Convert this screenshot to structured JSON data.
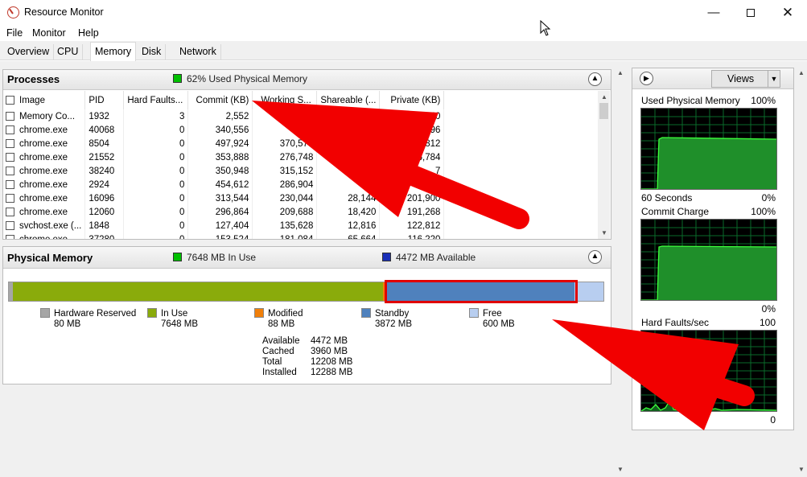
{
  "window": {
    "title": "Resource Monitor",
    "icons": {
      "app": "resource-monitor-icon",
      "minimize": "minimize-icon",
      "maximize": "maximize-icon",
      "close": "close-icon"
    }
  },
  "menu": [
    "File",
    "Monitor",
    "Help"
  ],
  "tabs": [
    "Overview",
    "CPU",
    "Memory",
    "Disk",
    "Network"
  ],
  "active_tab": "Memory",
  "processes": {
    "title": "Processes",
    "summary": "62% Used Physical Memory",
    "summary_color": "#00c000",
    "columns": [
      "Image",
      "PID",
      "Hard Faults...",
      "Commit (KB)",
      "Working S...",
      "Shareable (...",
      "Private (KB)"
    ],
    "rows": [
      [
        "Memory Co...",
        "1932",
        "3",
        "2,552",
        "",
        "0",
        "601,640"
      ],
      [
        "chrome.exe",
        "40068",
        "0",
        "340,556",
        "365",
        "",
        "3,796"
      ],
      [
        "chrome.exe",
        "8504",
        "0",
        "497,924",
        "370,576",
        "",
        "46,812"
      ],
      [
        "chrome.exe",
        "21552",
        "0",
        "353,888",
        "276,748",
        "",
        "246,784"
      ],
      [
        "chrome.exe",
        "38240",
        "0",
        "350,948",
        "315,152",
        "",
        "7"
      ],
      [
        "chrome.exe",
        "2924",
        "0",
        "454,612",
        "286,904",
        "65,",
        "22"
      ],
      [
        "chrome.exe",
        "16096",
        "0",
        "313,544",
        "230,044",
        "28,144",
        "201,900"
      ],
      [
        "chrome.exe",
        "12060",
        "0",
        "296,864",
        "209,688",
        "18,420",
        "191,268"
      ],
      [
        "svchost.exe (...",
        "1848",
        "0",
        "127,404",
        "135,628",
        "12,816",
        "122,812"
      ],
      [
        "chrome.exe",
        "37280",
        "0",
        "153,524",
        "181,084",
        "65,664",
        "116,220"
      ]
    ]
  },
  "physical_memory": {
    "title": "Physical Memory",
    "in_use_summary": "7648 MB In Use",
    "available_summary": "4472 MB Available",
    "bar": {
      "hardware_reserved": 80,
      "in_use": 7648,
      "modified": 88,
      "standby": 3872,
      "free": 600,
      "total": 12288
    },
    "legend": [
      {
        "label": "Hardware Reserved",
        "value": "80 MB",
        "color": "#a6a6a6"
      },
      {
        "label": "In Use",
        "value": "7648 MB",
        "color": "#8aab0b"
      },
      {
        "label": "Modified",
        "value": "88 MB",
        "color": "#f07f0a"
      },
      {
        "label": "Standby",
        "value": "3872 MB",
        "color": "#4f81bd"
      },
      {
        "label": "Free",
        "value": "600 MB",
        "color": "#b8cef0"
      }
    ],
    "stats": [
      {
        "label": "Available",
        "value": "4472 MB"
      },
      {
        "label": "Cached",
        "value": "3960 MB"
      },
      {
        "label": "Total",
        "value": "12208 MB"
      },
      {
        "label": "Installed",
        "value": "12288 MB"
      }
    ]
  },
  "side": {
    "views_label": "Views",
    "graphs": [
      {
        "title": "Used Physical Memory",
        "max": "100%",
        "footer_left": "60 Seconds",
        "footer_right": "0%"
      },
      {
        "title": "Commit Charge",
        "max": "100%",
        "footer_left": "",
        "footer_right": "0%"
      },
      {
        "title": "Hard Faults/sec",
        "max": "100",
        "footer_left": "",
        "footer_right": "0"
      }
    ]
  }
}
